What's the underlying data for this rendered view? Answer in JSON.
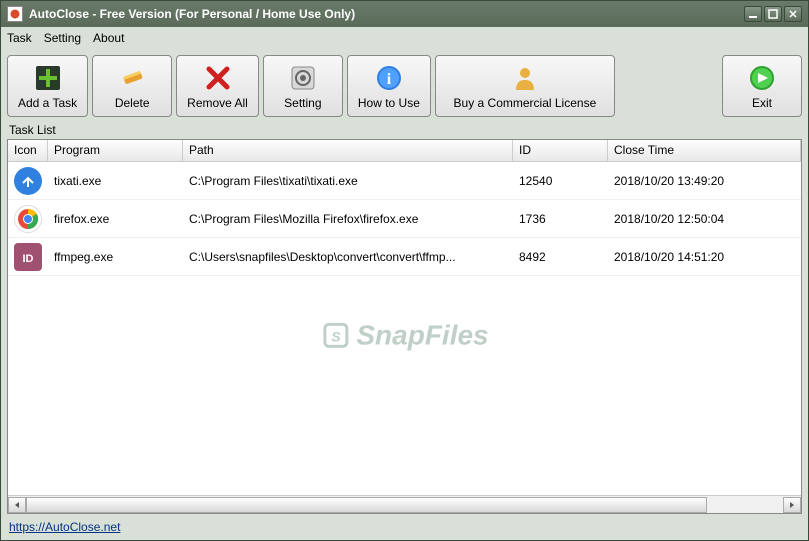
{
  "window": {
    "title": "AutoClose - Free Version (For Personal / Home Use Only)"
  },
  "menu": {
    "task": "Task",
    "setting": "Setting",
    "about": "About"
  },
  "toolbar": {
    "add": "Add a Task",
    "delete": "Delete",
    "removeall": "Remove All",
    "setting": "Setting",
    "howto": "How to Use",
    "buy": "Buy a Commercial License",
    "exit": "Exit"
  },
  "listlabel": "Task List",
  "columns": {
    "icon": "Icon",
    "program": "Program",
    "path": "Path",
    "id": "ID",
    "closetime": "Close Time"
  },
  "rows": [
    {
      "program": "tixati.exe",
      "path": "C:\\Program Files\\tixati\\tixati.exe",
      "id": "12540",
      "closetime": "2018/10/20 13:49:20"
    },
    {
      "program": "firefox.exe",
      "path": "C:\\Program Files\\Mozilla Firefox\\firefox.exe",
      "id": "1736",
      "closetime": "2018/10/20 12:50:04"
    },
    {
      "program": "ffmpeg.exe",
      "path": "C:\\Users\\snapfiles\\Desktop\\convert\\convert\\ffmp...",
      "id": "8492",
      "closetime": "2018/10/20 14:51:20"
    }
  ],
  "watermark": "SnapFiles",
  "footer": "https://AutoClose.net"
}
